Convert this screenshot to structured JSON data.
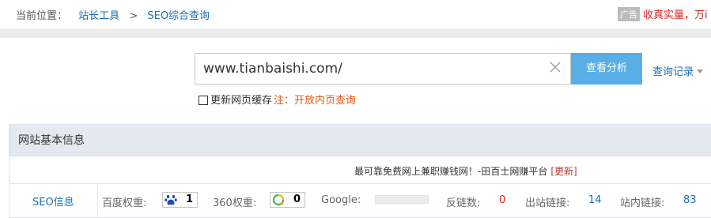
{
  "breadcrumb": {
    "label": "当前位置：",
    "item1": "站长工具",
    "sep": ">",
    "item2": "SEO综合查询"
  },
  "ad": {
    "tag": "广告",
    "text": "收真实量，万i"
  },
  "search": {
    "value": "www.tianbaishi.com/",
    "analyze_button": "查看分析",
    "history_label": "查询记录"
  },
  "cache": {
    "checkbox_label": "更新网页缓存",
    "note": "注：开放内页查询"
  },
  "info": {
    "title": "网站基本信息",
    "promo_text": "最可靠免费网上兼职赚钱网！-田百士网赚平台",
    "promo_update": "[更新]",
    "seo_label": "SEO信息",
    "baidu_label": "百度权重:",
    "baidu_value": "1",
    "r360_label": "360权重:",
    "r360_value": "0",
    "google_label": "Google:",
    "backlinks_label": "反链数:",
    "backlinks_value": "0",
    "outlinks_label": "出站链接:",
    "outlinks_value": "14",
    "inlinks_label": "站内链接:",
    "inlinks_value": "83"
  },
  "colors": {
    "link": "#1a6fb5",
    "accent_button": "#5aaee6",
    "danger": "#e02020"
  }
}
